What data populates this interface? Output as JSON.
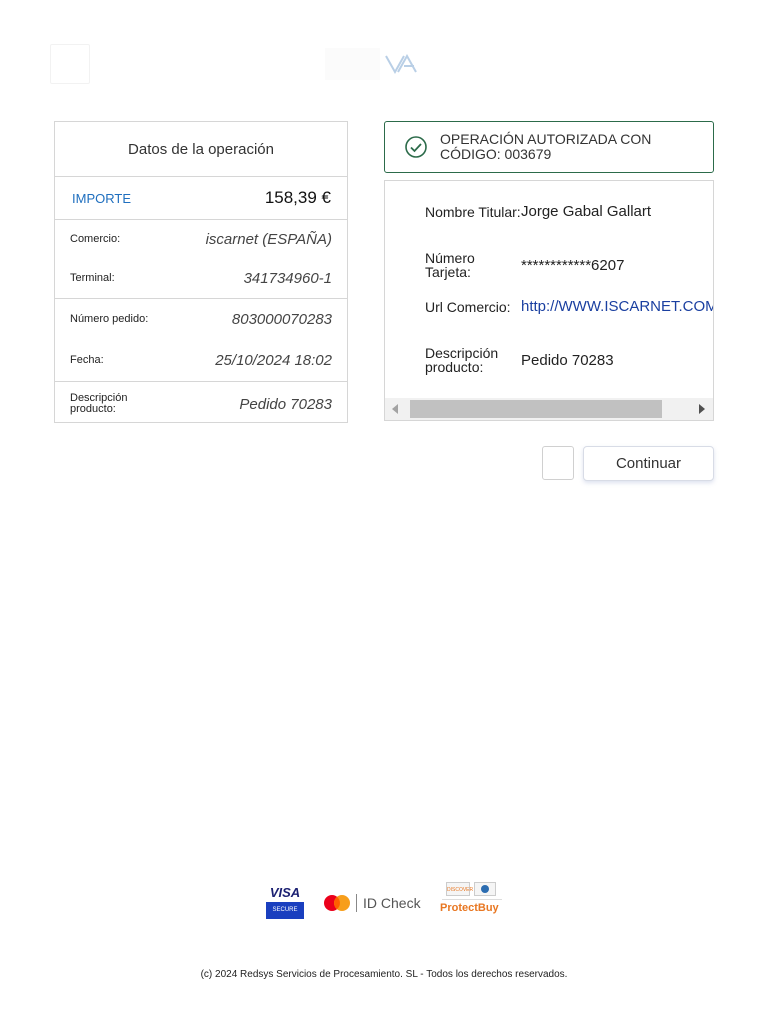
{
  "operation": {
    "title": "Datos de la operación",
    "importe_label": "IMPORTE",
    "importe_value": "158,39  €",
    "rows": [
      {
        "label": "Comercio:",
        "value": "iscarnet (ESPAÑA)"
      },
      {
        "label": "Terminal:",
        "value": "341734960-1"
      },
      {
        "label": "Número pedido:",
        "value": "803000070283"
      },
      {
        "label": "Fecha:",
        "value": "25/10/2024   18:02"
      },
      {
        "label": "Descripción producto:",
        "value": "Pedido 70283"
      }
    ]
  },
  "authorization": {
    "line1": "OPERACIÓN AUTORIZADA CON",
    "line2": "CÓDIGO:  003679"
  },
  "details": [
    {
      "label": "Nombre Titular:",
      "value": "Jorge Gabal Gallart"
    },
    {
      "label": "Número Tarjeta:",
      "value": "************6207"
    },
    {
      "label": "Url Comercio:",
      "value": "http://WWW.ISCARNET.COM"
    },
    {
      "label": "Descripción producto:",
      "value": "Pedido 70283"
    }
  ],
  "buttons": {
    "continue_label": "Continuar"
  },
  "footer": {
    "visa_text": "VISA",
    "visa_secure": "SECURE",
    "idcheck_text": "ID Check",
    "discover_text": "DISCOVER",
    "protectbuy_text": "ProtectBuy",
    "copyright": "(c) 2024 Redsys Servicios de Procesamiento. SL - Todos los derechos reservados."
  },
  "colors": {
    "accent": "#1f6fbf",
    "success": "#2c6b4a",
    "link": "#1a3fa0"
  }
}
